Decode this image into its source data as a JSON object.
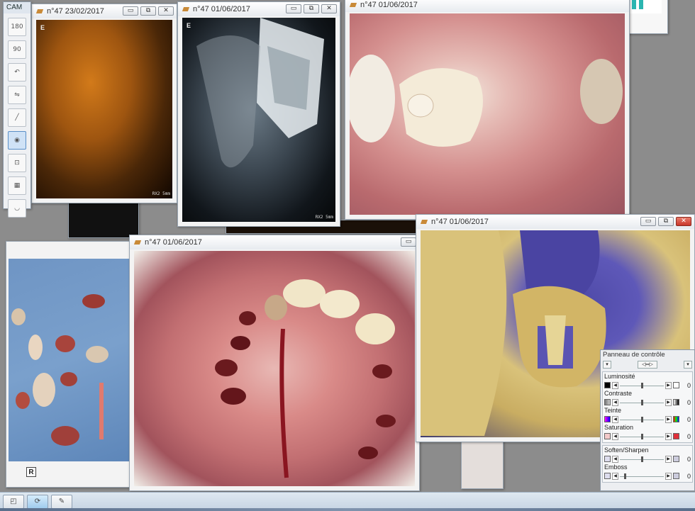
{
  "toolbar": {
    "title": "CAM",
    "tools": [
      {
        "label": "180",
        "icon": "rotate-180-icon"
      },
      {
        "label": "90",
        "icon": "rotate-90-icon"
      },
      {
        "label": "↶",
        "icon": "rotate-left-icon"
      },
      {
        "label": "⇋",
        "icon": "flip-horizontal-icon"
      },
      {
        "label": "╱",
        "icon": "draw-line-icon"
      },
      {
        "label": "◉",
        "icon": "eye-icon"
      },
      {
        "label": "⊡",
        "icon": "crop-icon"
      },
      {
        "label": "▦",
        "icon": "contrast-icon"
      },
      {
        "label": "◡",
        "icon": "smile-icon"
      }
    ]
  },
  "windows": {
    "cone_beam": {
      "title": "n°47 23/02/2017",
      "letter": "E",
      "scale": "RX2 5mm"
    },
    "xray": {
      "title": "n°47 01/06/2017",
      "letter": "E",
      "scale": "RX2 5mm"
    },
    "photo_occlusal": {
      "title": "n°47 01/06/2017"
    },
    "photo_extraction": {
      "title": "n°47 01/06/2017"
    },
    "photo_impression": {
      "title": "n°47 01/06/2017"
    },
    "extracted_teeth": {
      "letter": "R"
    }
  },
  "control_panel": {
    "title": "Panneau de contrôle",
    "groups": [
      {
        "label": "Luminosité",
        "value": "0"
      },
      {
        "label": "Contraste",
        "value": "0"
      },
      {
        "label": "Teinte",
        "value": "0"
      },
      {
        "label": "Saturation",
        "value": "0"
      },
      {
        "label": "Soften/Sharpen",
        "value": "0"
      },
      {
        "label": "Emboss",
        "value": "0"
      }
    ]
  },
  "controls": {
    "minimize": "▭",
    "maximize": "⧉",
    "close": "✕"
  }
}
